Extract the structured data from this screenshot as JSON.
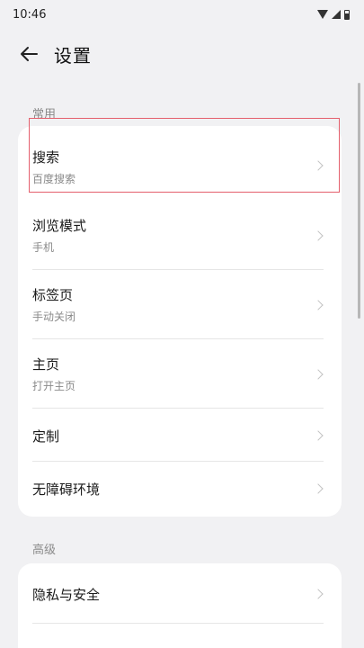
{
  "status_bar": {
    "time": "10:46",
    "icons": [
      "wifi-icon",
      "signal-icon",
      "battery-icon"
    ]
  },
  "app_bar": {
    "back_icon": "arrow-left-icon",
    "title": "设置"
  },
  "sections": [
    {
      "header": "常用",
      "items": [
        {
          "title": "搜索",
          "subtitle": "百度搜索"
        },
        {
          "title": "浏览模式",
          "subtitle": "手机"
        },
        {
          "title": "标签页",
          "subtitle": "手动关闭"
        },
        {
          "title": "主页",
          "subtitle": "打开主页"
        },
        {
          "title": "定制",
          "subtitle": ""
        },
        {
          "title": "无障碍环境",
          "subtitle": ""
        }
      ]
    },
    {
      "header": "高级",
      "items": [
        {
          "title": "隐私与安全",
          "subtitle": ""
        }
      ]
    }
  ],
  "colors": {
    "background": "#f1f1f3",
    "card": "#ffffff",
    "highlight": "#e4606d"
  }
}
